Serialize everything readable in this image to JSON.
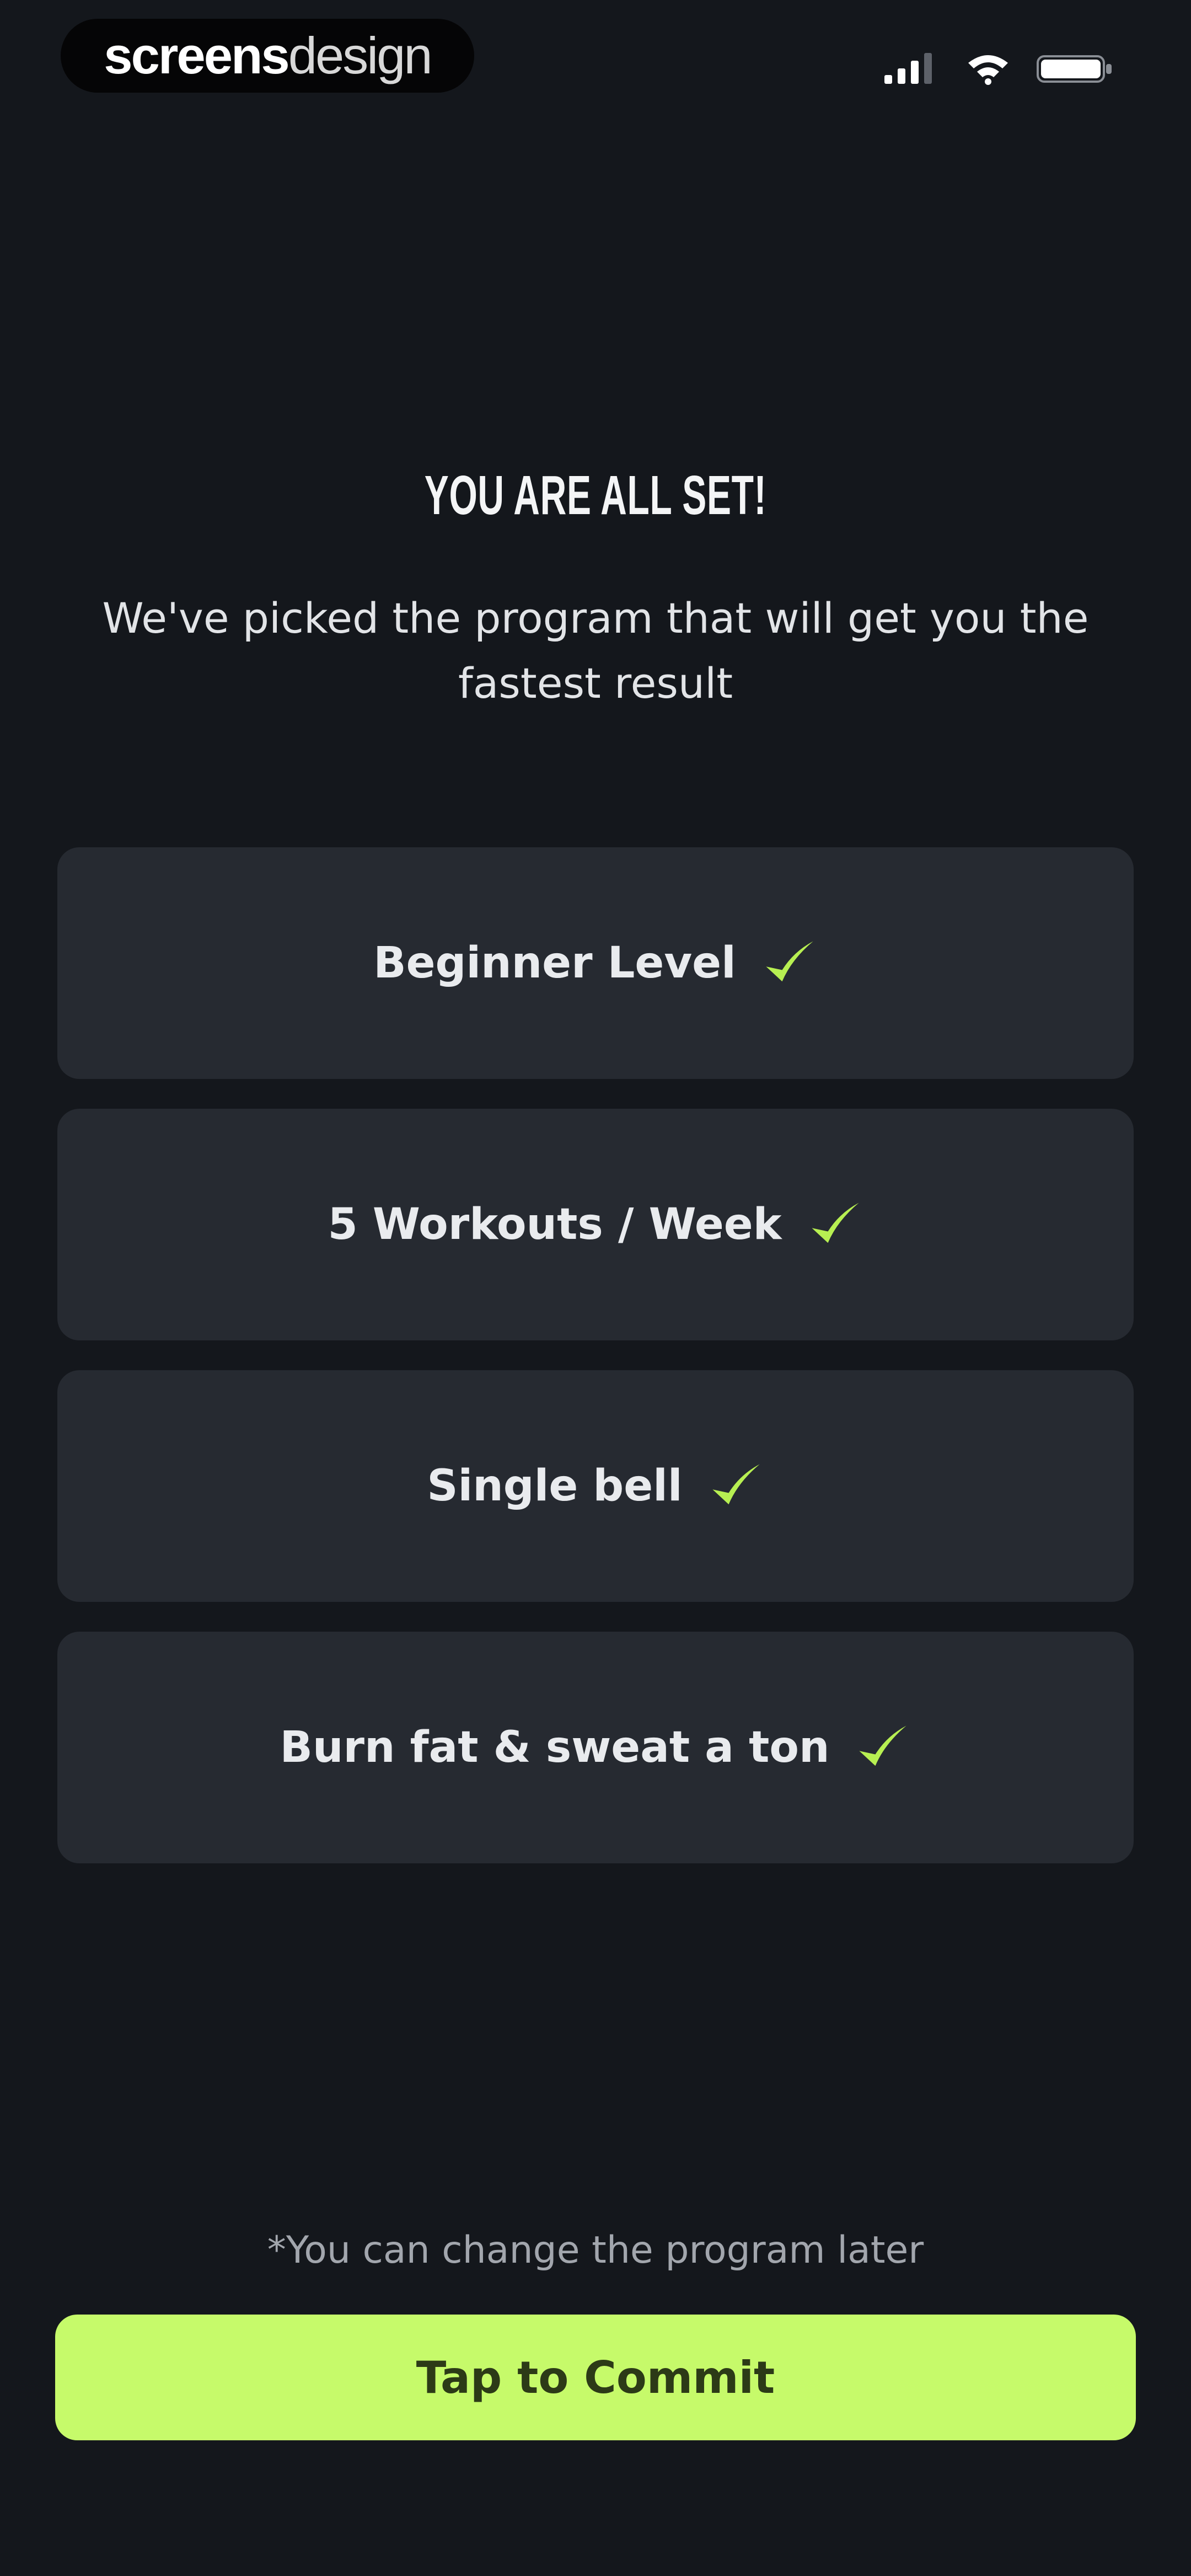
{
  "status_bar": {
    "brand_strong": "screens",
    "brand_light": "design",
    "icons": [
      "signal-icon",
      "wifi-icon",
      "battery-icon"
    ]
  },
  "header": {
    "title": "YOU ARE ALL SET!",
    "subtitle": "We've picked the program that will get you the fastest result"
  },
  "selections": [
    {
      "label": "Beginner Level",
      "icon": "check-icon"
    },
    {
      "label": "5 Workouts / Week",
      "icon": "check-icon"
    },
    {
      "label": "Single bell",
      "icon": "check-icon"
    },
    {
      "label": "Burn fat & sweat a ton",
      "icon": "check-icon"
    }
  ],
  "footer": {
    "note": "*You can change the program later",
    "commit_label": "Tap to Commit"
  },
  "colors": {
    "background": "#14171c",
    "card": "#262a31",
    "accent": "#c6fa6a",
    "check": "#b7ef52"
  }
}
